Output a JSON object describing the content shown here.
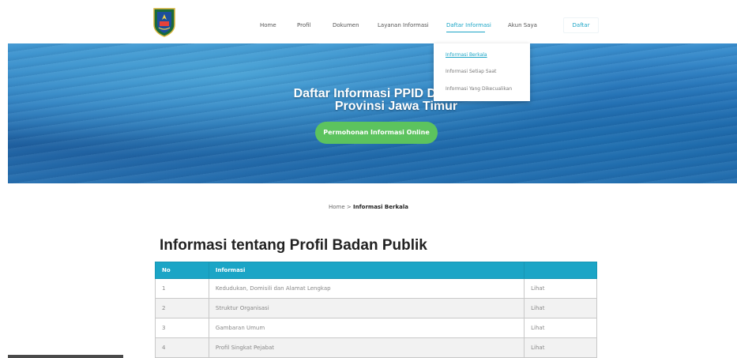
{
  "nav": {
    "items": [
      {
        "label": "Home"
      },
      {
        "label": "Profil"
      },
      {
        "label": "Dokumen"
      },
      {
        "label": "Layanan Informasi"
      },
      {
        "label": "Daftar Informasi"
      },
      {
        "label": "Akun Saya"
      }
    ],
    "active_item": "Daftar Informasi",
    "register_label": "Daftar"
  },
  "hero": {
    "title_line1": "Daftar Informasi PPID Dinas Kepemud",
    "title_line2": "Provinsi Jawa Timur",
    "button_label": "Permohonan Informasi Online"
  },
  "dropdown": {
    "items": [
      {
        "label": "Informasi Berkala"
      },
      {
        "label": "Informasi Setiap Saat"
      },
      {
        "label": "Informasi Yang Dikecualikan"
      }
    ],
    "active_item": "Informasi Berkala"
  },
  "breadcrumb": {
    "home": "Home",
    "separator": " > ",
    "current": "Informasi Berkala"
  },
  "section": {
    "title": "Informasi tentang Profil Badan Publik"
  },
  "table": {
    "headers": [
      "No",
      "Informasi",
      ""
    ],
    "rows": [
      {
        "no": "1",
        "info": "Kedudukan, Domisili dan Alamat Lengkap",
        "action": "Lihat"
      },
      {
        "no": "2",
        "info": "Struktur Organisasi",
        "action": "Lihat"
      },
      {
        "no": "3",
        "info": "Gambaran Umum",
        "action": "Lihat"
      },
      {
        "no": "4",
        "info": "Profil Singkat Pejabat",
        "action": "Lihat"
      }
    ]
  },
  "colors": {
    "accent": "#1ba5c6",
    "button_green": "#5cc35e",
    "hero_blue": "#2a76bb"
  },
  "icons": {
    "logo": "east-java-province-crest-icon"
  }
}
